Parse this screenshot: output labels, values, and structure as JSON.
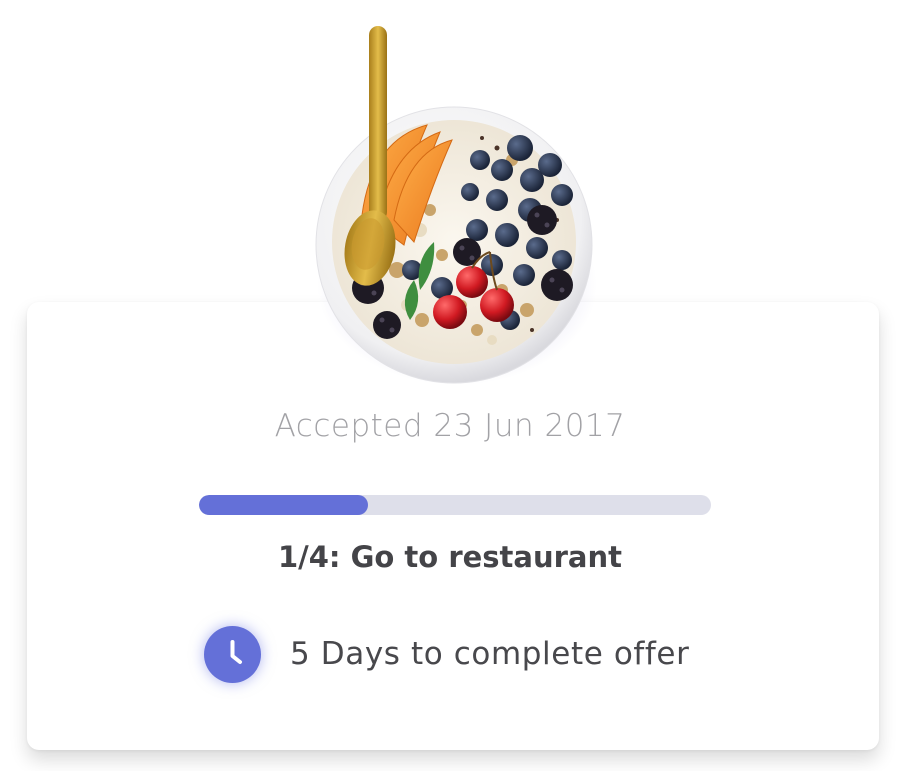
{
  "offer": {
    "image": {
      "name": "fruit-bowl-image",
      "description_icon": "acai-bowl-with-berries-and-spoon"
    },
    "accepted_text": "Accepted 23 Jun 2017",
    "progress": {
      "current_step": 1,
      "total_steps": 4,
      "fraction": 0.33
    },
    "step_label": "1/4: Go to restaurant",
    "deadline": {
      "icon": "clock-icon",
      "text": "5 Days to complete offer"
    }
  },
  "colors": {
    "accent": "#6470d8",
    "track": "#dedfea",
    "muted_text": "#a2a2a6",
    "body_text": "#48484c"
  }
}
